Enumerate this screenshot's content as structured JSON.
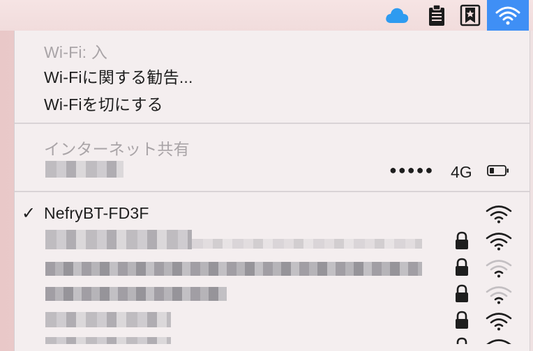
{
  "menubar": {
    "icons": [
      "cloud-icon",
      "clipboard-icon",
      "reading-list-icon",
      "wifi-icon"
    ]
  },
  "menu": {
    "wifi_status": "Wi-Fi: 入",
    "wifi_advisory": "Wi-Fiに関する勧告...",
    "wifi_off": "Wi-Fiを切にする",
    "hotspot_header": "インターネット共有",
    "hotspot": {
      "signal": "●●●●●",
      "network_type": "4G"
    },
    "networks": [
      {
        "name": "NefryBT-FD3F",
        "connected": true,
        "locked": false,
        "strength": 3
      },
      {
        "name": "",
        "connected": false,
        "locked": true,
        "strength": 3
      },
      {
        "name": "",
        "connected": false,
        "locked": true,
        "strength": 1
      },
      {
        "name": "",
        "connected": false,
        "locked": true,
        "strength": 1
      },
      {
        "name": "",
        "connected": false,
        "locked": true,
        "strength": 3
      }
    ]
  },
  "colors": {
    "accent_blue": "#3f8ff5",
    "icloud_blue": "#2e9bf0",
    "text": "#1e1e1e",
    "disabled_text": "#a9a4a7"
  }
}
